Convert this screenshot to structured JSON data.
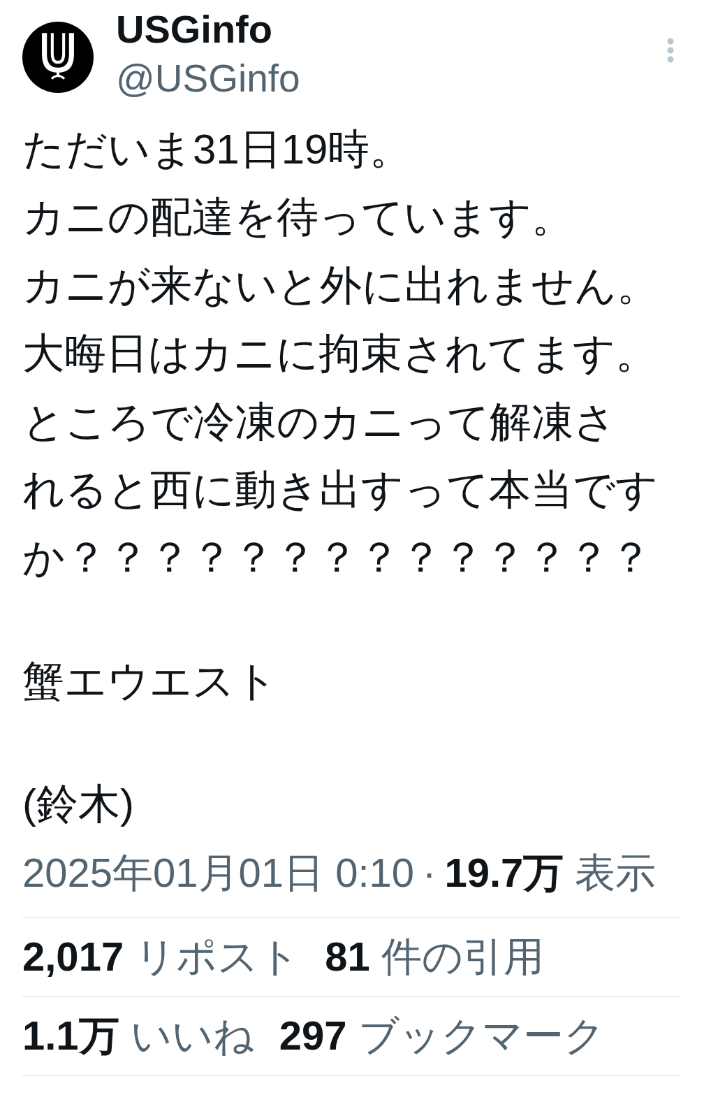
{
  "author": {
    "name": "USGinfo",
    "handle": "@USGinfo"
  },
  "post": {
    "paragraphs": [
      {
        "lines": [
          "ただいま31日19時。",
          "カニの配達を待っています。",
          "カニが来ないと外に出れません。",
          "大晦日はカニに拘束されてます。",
          "ところで冷凍のカニって解凍されると西に動き出すって本当ですか？？？？？？？？？？？？？？"
        ]
      },
      {
        "lines": [
          "蟹エウエスト"
        ]
      },
      {
        "lines": [
          "(鈴木)"
        ]
      }
    ]
  },
  "meta": {
    "timestamp": "2025年01月01日 0:10",
    "separator": "·",
    "views_count": "19.7万",
    "views_label": "表示"
  },
  "stat_rows": [
    {
      "items": [
        {
          "count": "2,017",
          "label": "リポスト"
        },
        {
          "count": "81",
          "label": "件の引用"
        }
      ]
    },
    {
      "items": [
        {
          "count": "1.1万",
          "label": "いいね"
        },
        {
          "count": "297",
          "label": "ブックマーク"
        }
      ]
    }
  ]
}
